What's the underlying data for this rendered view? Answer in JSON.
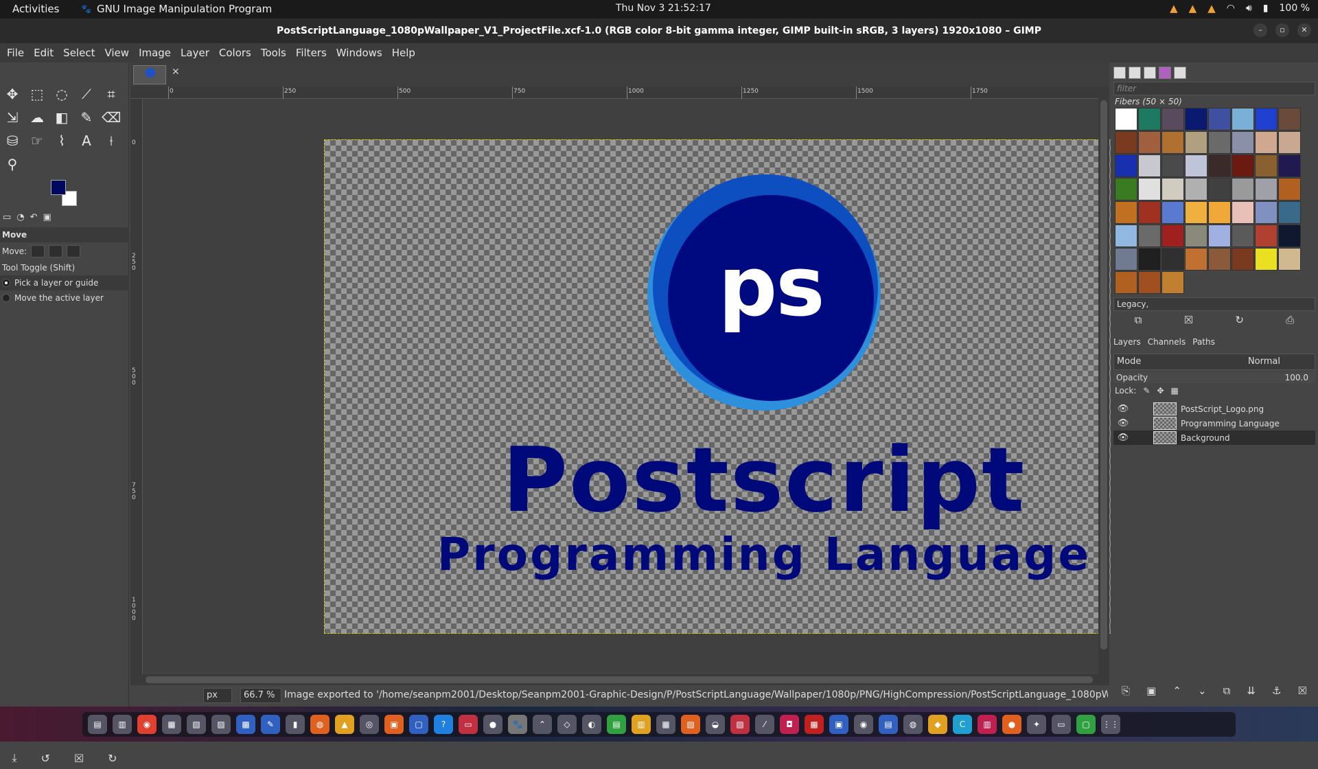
{
  "topbar": {
    "activities": "Activities",
    "app_name": "GNU Image Manipulation Program",
    "clock": "Thu Nov 3  21:52:17",
    "battery": "100 %"
  },
  "window": {
    "title": "PostScriptLanguage_1080pWallpaper_V1_ProjectFile.xcf-1.0 (RGB color 8-bit gamma integer, GIMP built-in sRGB, 3 layers) 1920x1080 – GIMP"
  },
  "menu": [
    "File",
    "Edit",
    "Select",
    "View",
    "Image",
    "Layer",
    "Colors",
    "Tools",
    "Filters",
    "Windows",
    "Help"
  ],
  "tool_options": {
    "heading": "Move",
    "move_label": "Move:",
    "toggle_label": "Tool Toggle  (Shift)",
    "option1": "Pick a layer or guide",
    "option2": "Move the active layer"
  },
  "colors": {
    "foreground": "#00095f",
    "background": "#ffffff"
  },
  "rulers": {
    "h_labels": [
      "0",
      "250",
      "500",
      "750",
      "1000",
      "1250",
      "1500",
      "1750"
    ],
    "v_labels": [
      "0",
      "250",
      "500",
      "750",
      "1000"
    ]
  },
  "canvas": {
    "logo_text": "ps",
    "title": "Postscript",
    "subtitle": "Programming Language"
  },
  "status": {
    "unit": "px",
    "zoom": "66.7 %",
    "message": "Image exported to '/home/seanpm2001/Desktop/Seanpm2001-Graphic-Design/P/PostScriptLanguage/Wallpaper/1080p/PNG/HighCompression/PostScriptLanguage_1080pW..."
  },
  "dock": {
    "filter_placeholder": "filter",
    "pattern_name": "Fibers (50 × 50)",
    "pattern_tag": "Legacy,",
    "tabs": {
      "layers": "Layers",
      "channels": "Channels",
      "paths": "Paths"
    },
    "mode_label": "Mode",
    "mode_value": "Normal",
    "opacity_label": "Opacity",
    "opacity_value": "100.0",
    "lock_label": "Lock:",
    "layers": [
      "PostScript_Logo.png",
      "Programming Language",
      "Background"
    ]
  }
}
